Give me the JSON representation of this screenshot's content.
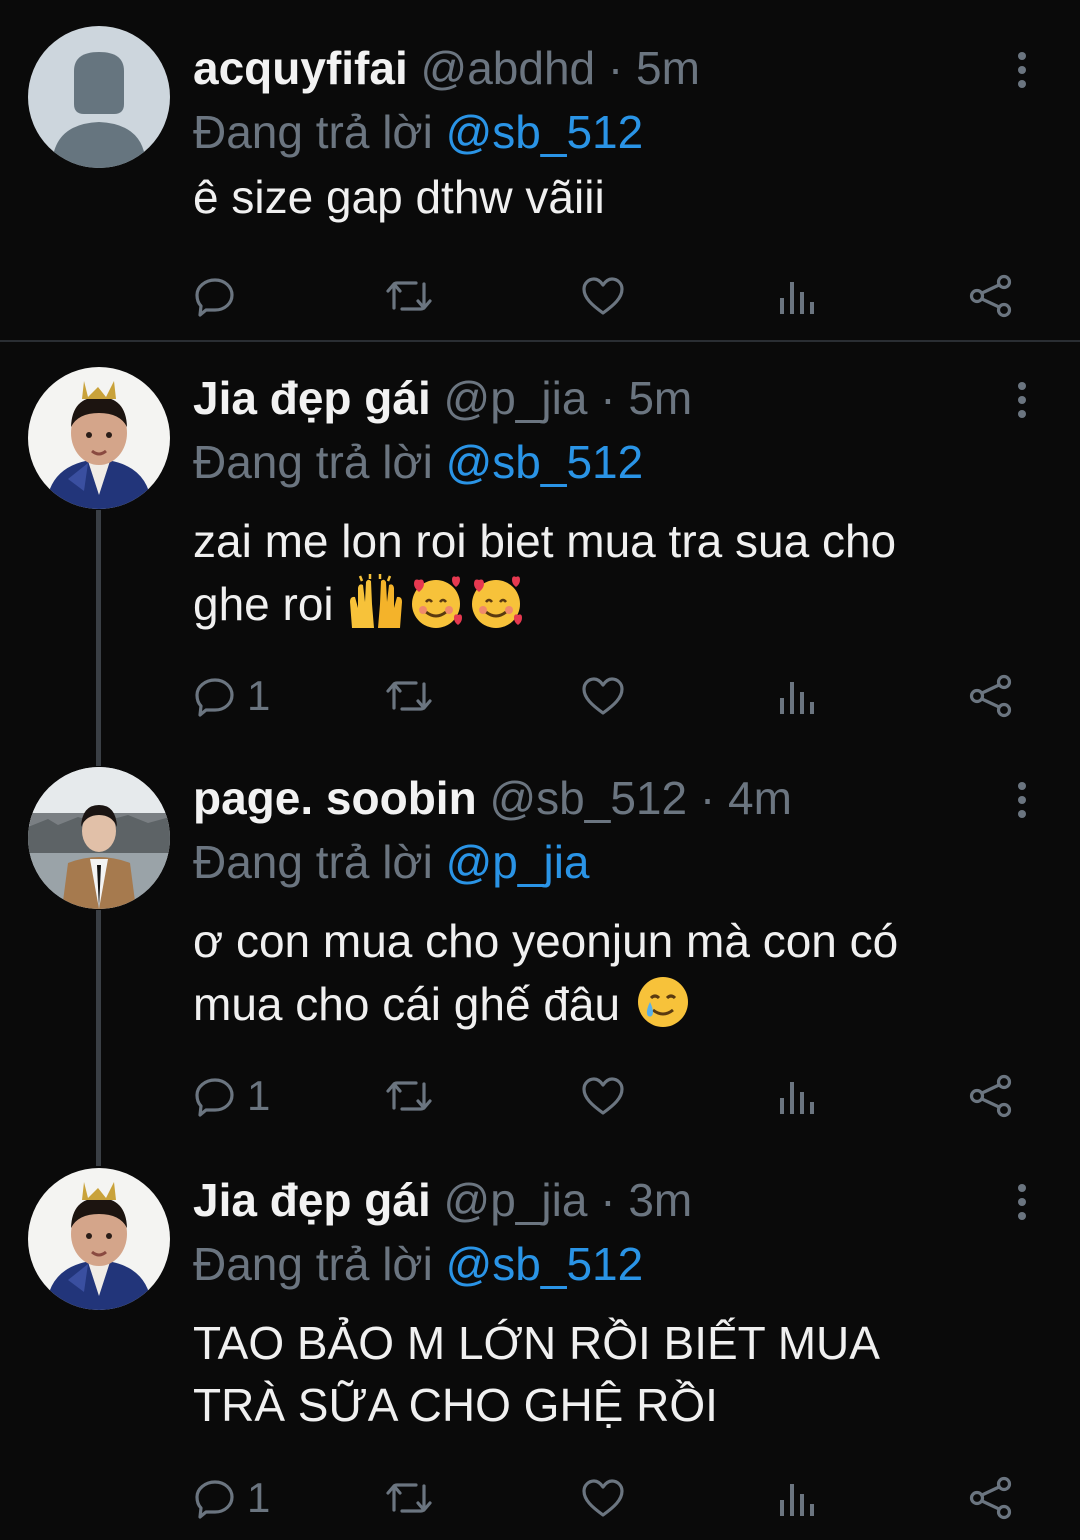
{
  "tweets": [
    {
      "name": "acquyfifai",
      "handle": "@abdhd",
      "sep": " · ",
      "time": "5m",
      "reply_label": "Đang trả lời ",
      "reply_to": "@sb_512",
      "text_line1": "ê size gap dthw vãiii",
      "text_line2": "",
      "reply_count": ""
    },
    {
      "name": "Jia đẹp gái",
      "handle": "@p_jia",
      "sep": " · ",
      "time": "5m",
      "reply_label": "Đang trả lời ",
      "reply_to": "@sb_512",
      "text_line1": "zai me lon roi biet mua tra sua cho",
      "text_line2": "ghe roi",
      "reply_count": "1"
    },
    {
      "name": "page. soobin",
      "handle": "@sb_512",
      "sep": " · ",
      "time": "4m",
      "reply_label": "Đang trả lời ",
      "reply_to": "@p_jia",
      "text_line1": "ơ con mua cho yeonjun mà con có",
      "text_line2": "mua cho cái ghế đâu",
      "reply_count": "1"
    },
    {
      "name": "Jia đẹp gái",
      "handle": "@p_jia",
      "sep": " · ",
      "time": "3m",
      "reply_label": "Đang trả lời ",
      "reply_to": "@sb_512",
      "text_line1": "TAO BẢO M LỚN RỒI BIẾT MUA",
      "text_line2": "TRÀ SỮA CHO GHỆ RỒI",
      "reply_count": "1"
    }
  ],
  "emojis": {
    "tweet2": [
      "raising-hands",
      "smiling-face-with-hearts",
      "smiling-face-with-hearts"
    ],
    "tweet3": [
      "smiling-face-with-tear"
    ]
  },
  "colors": {
    "background": "#0a0a0a",
    "secondary_text": "#6b7580",
    "mention": "#2a94e6",
    "icon": "#6b7580"
  },
  "icons": [
    "reply-icon",
    "retweet-icon",
    "like-icon",
    "analytics-icon",
    "share-icon",
    "more-options-icon"
  ]
}
